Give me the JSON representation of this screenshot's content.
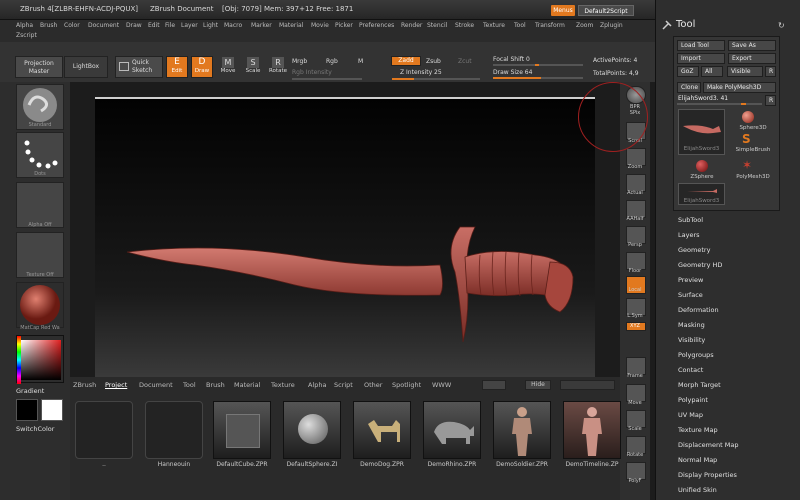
{
  "titlebar": {
    "app": "ZBrush 4[ZLBR-EHFN-ACDJ-PQUX]",
    "doc": "ZBrush Document",
    "stats": "[Obj: 7079] Mem: 397+12 Free: 1871",
    "menus_btn": "Menus",
    "script_btn": "Default2Script"
  },
  "menubar": {
    "row1": [
      "Alpha",
      "Brush",
      "Color",
      "Document",
      "Draw",
      "Edit",
      "File",
      "Layer",
      "Light",
      "Macro",
      "Marker",
      "Material",
      "Movie",
      "Picker",
      "Preferences",
      "Render",
      "Stencil",
      "Stroke",
      "Texture",
      "Tool",
      "Transform",
      "Zoom",
      "Zplugin"
    ],
    "row2": "Zscript"
  },
  "topshelf": {
    "projection_master": "Projection Master",
    "lightbox": "LightBox",
    "quick_sketch": "Quick Sketch",
    "edit": "Edit",
    "draw": "Draw",
    "move": "Move",
    "scale": "Scale",
    "rotate": "Rotate",
    "mrgb": "Mrgb",
    "rgb": "Rgb",
    "m": "M",
    "rgb_intensity": "Rgb Intensity",
    "zadd": "Zadd",
    "zsub": "Zsub",
    "zcut": "Zcut",
    "z_intensity": "Z Intensity 25",
    "z_intensity_value": 25,
    "focal_shift": "Focal Shift 0",
    "draw_size": "Draw Size 64",
    "active_points": "ActivePoints: 4",
    "total_points": "TotalPoints: 4,9",
    "icons": {
      "edit": "E",
      "draw": "D",
      "move": "M",
      "scale": "S",
      "rotate": "R"
    }
  },
  "leftshelf": {
    "standard": "Standard",
    "dots": "Dots",
    "alpha_off": "Alpha Off",
    "texture_off": "Texture Off",
    "matcap": "MatCap Red Wa",
    "gradient": "Gradient",
    "switchcolor": "SwitchColor"
  },
  "rightshelf": {
    "buttons": [
      "BPR",
      "SPix",
      "Scroll",
      "Zoom",
      "Actual",
      "AAHalf",
      "Persp",
      "Floor",
      "Local",
      "L.Sym",
      "XYZ",
      "",
      "",
      "Frame",
      "Move",
      "Scale",
      "Rotate",
      "PolyF"
    ]
  },
  "lightbox": {
    "tabs": [
      "ZBrush",
      "Project",
      "Document",
      "Tool",
      "Brush",
      "Material",
      "Texture",
      "Alpha",
      "Script",
      "Other",
      "Spotlight",
      "WWW"
    ],
    "active_tab": "Project",
    "hide": "Hide",
    "items": [
      "..",
      "Hanneouin",
      "DefaultCube.ZPR",
      "DefaultSphere.ZI",
      "DemoDog.ZPR",
      "DemoRhino.ZPR",
      "DemoSoldier.ZPR",
      "DemoTimeline.ZP"
    ]
  },
  "tray": {
    "title": "Tool",
    "load_tool": "Load Tool",
    "save_as": "Save As",
    "import": "Import",
    "export": "Export",
    "goz": "GoZ",
    "all": "All",
    "visible": "Visible",
    "r": "R",
    "clone": "Clone",
    "make_polymesh": "Make PolyMesh3D",
    "current_tool": "ElijahSword3. 41",
    "tools": [
      "ElijahSword3",
      "Sphere3D",
      "SimpleBrush",
      "ZSphere",
      "PolyMesh3D",
      "ElijahSword3"
    ],
    "sections": [
      "SubTool",
      "Layers",
      "Geometry",
      "Geometry HD",
      "Preview",
      "Surface",
      "Deformation",
      "Masking",
      "Visibility",
      "Polygroups",
      "Contact",
      "Morph Target",
      "Polypaint",
      "UV Map",
      "Texture Map",
      "Displacement Map",
      "Normal Map",
      "Display Properties",
      "Unified Skin"
    ]
  },
  "colors": {
    "accent": "#e2791f",
    "mesh": "#c66a62",
    "bg": "#1c1c1c"
  }
}
